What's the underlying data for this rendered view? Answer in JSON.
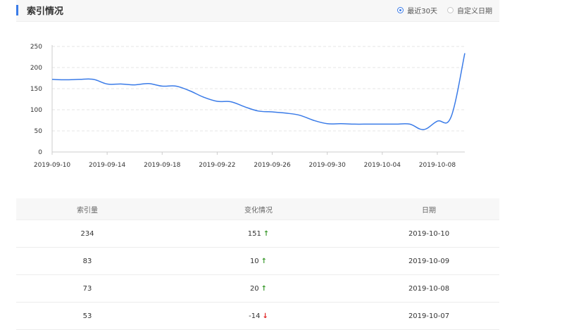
{
  "header": {
    "title": "索引情况",
    "options": [
      {
        "label": "最近30天",
        "checked": true
      },
      {
        "label": "自定义日期",
        "checked": false
      }
    ]
  },
  "chart_data": {
    "type": "line",
    "ylim": [
      0,
      250
    ],
    "yticks": [
      "0",
      "50",
      "100",
      "150",
      "200",
      "250"
    ],
    "xticks": [
      "2019-09-10",
      "2019-09-14",
      "2019-09-18",
      "2019-09-22",
      "2019-09-26",
      "2019-09-30",
      "2019-10-04",
      "2019-10-08"
    ],
    "x": [
      "2019-09-10",
      "2019-09-11",
      "2019-09-12",
      "2019-09-13",
      "2019-09-14",
      "2019-09-15",
      "2019-09-16",
      "2019-09-17",
      "2019-09-18",
      "2019-09-19",
      "2019-09-20",
      "2019-09-21",
      "2019-09-22",
      "2019-09-23",
      "2019-09-24",
      "2019-09-25",
      "2019-09-26",
      "2019-09-27",
      "2019-09-28",
      "2019-09-29",
      "2019-09-30",
      "2019-10-01",
      "2019-10-02",
      "2019-10-03",
      "2019-10-04",
      "2019-10-05",
      "2019-10-06",
      "2019-10-07",
      "2019-10-08",
      "2019-10-09",
      "2019-10-10"
    ],
    "values": [
      172,
      171,
      172,
      172,
      161,
      161,
      159,
      162,
      156,
      156,
      145,
      130,
      120,
      119,
      107,
      97,
      95,
      92,
      87,
      75,
      67,
      67,
      66,
      66,
      66,
      66,
      66,
      53,
      73,
      83,
      234
    ],
    "grid": true,
    "color": "#3a7be8"
  },
  "table": {
    "headers": [
      "索引量",
      "变化情况",
      "日期"
    ],
    "rows": [
      {
        "count": "234",
        "change": "151",
        "direction": "up",
        "date": "2019-10-10"
      },
      {
        "count": "83",
        "change": "10",
        "direction": "up",
        "date": "2019-10-09"
      },
      {
        "count": "73",
        "change": "20",
        "direction": "up",
        "date": "2019-10-08"
      },
      {
        "count": "53",
        "change": "-14",
        "direction": "down",
        "date": "2019-10-07"
      }
    ]
  },
  "icons": {
    "up": "↑",
    "down": "↓"
  }
}
